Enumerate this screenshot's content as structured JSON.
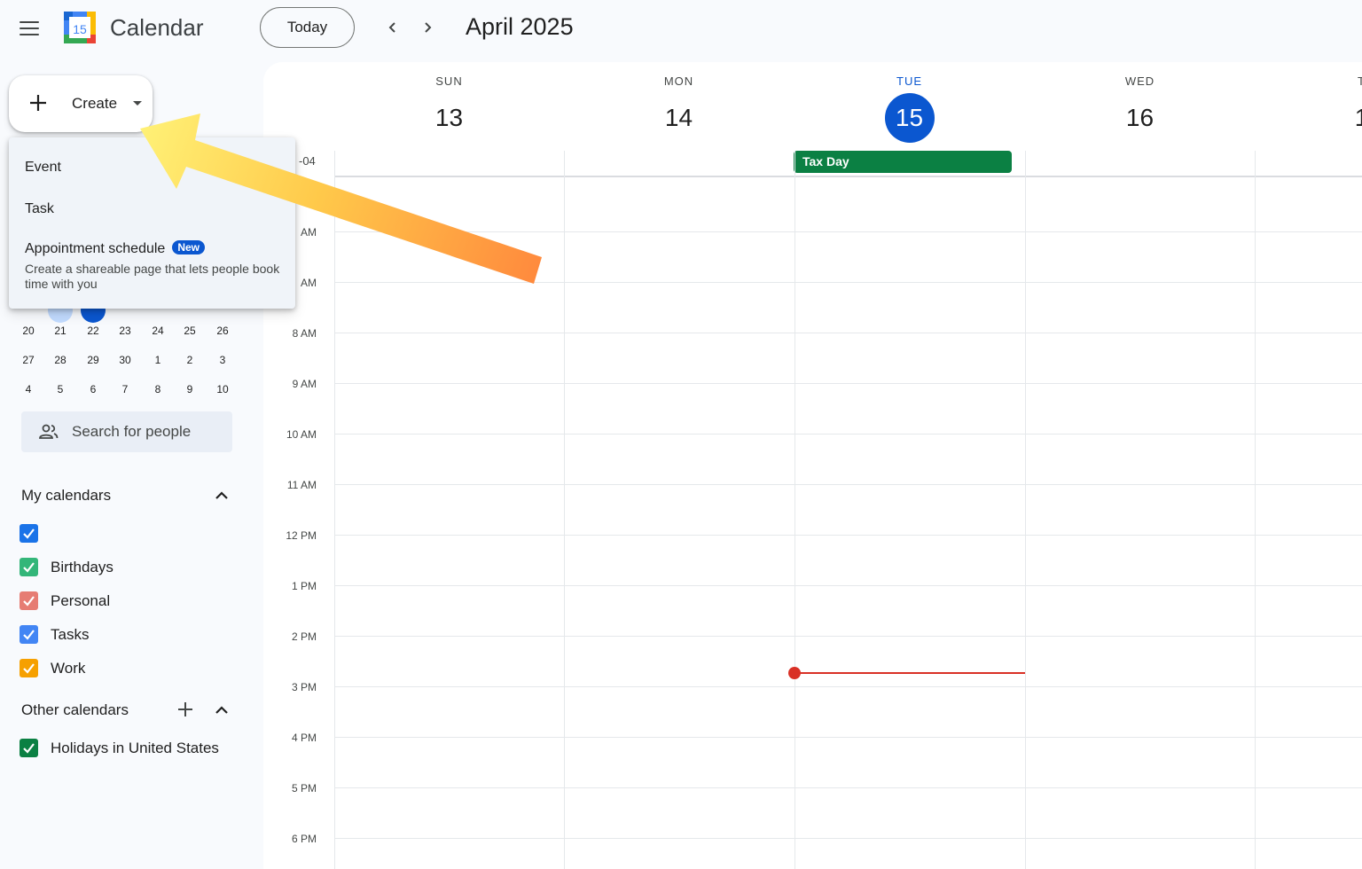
{
  "header": {
    "menu_icon": "hamburger-menu-icon",
    "logo_number": "15",
    "app_title": "Calendar",
    "today_label": "Today",
    "month_title": "April 2025"
  },
  "create": {
    "label": "Create",
    "menu": {
      "event": "Event",
      "task": "Task",
      "appointment": "Appointment schedule",
      "appointment_badge": "New",
      "appointment_desc": "Create a shareable page that lets people book time with you"
    }
  },
  "mini_calendar": {
    "rows": [
      [
        "20",
        "21",
        "22",
        "23",
        "24",
        "25",
        "26"
      ],
      [
        "27",
        "28",
        "29",
        "30",
        "1",
        "2",
        "3"
      ],
      [
        "4",
        "5",
        "6",
        "7",
        "8",
        "9",
        "10"
      ]
    ]
  },
  "search_people": {
    "placeholder": "Search for people"
  },
  "my_calendars": {
    "title": "My calendars",
    "items": [
      {
        "name": "",
        "color": "#1a73e8"
      },
      {
        "name": "Birthdays",
        "color": "#33b679"
      },
      {
        "name": "Personal",
        "color": "#e67c73"
      },
      {
        "name": "Tasks",
        "color": "#4285f4"
      },
      {
        "name": "Work",
        "color": "#f6a000"
      }
    ]
  },
  "other_calendars": {
    "title": "Other calendars",
    "items": [
      {
        "name": "Holidays in United States",
        "color": "#0b8043"
      }
    ]
  },
  "week": {
    "days": [
      {
        "dow": "SUN",
        "num": "13",
        "today": false
      },
      {
        "dow": "MON",
        "num": "14",
        "today": false
      },
      {
        "dow": "TUE",
        "num": "15",
        "today": true
      },
      {
        "dow": "WED",
        "num": "16",
        "today": false
      },
      {
        "dow": "T",
        "num": "1",
        "today": false
      }
    ],
    "timezone": "-04",
    "allday_event": "Tax Day",
    "hours": [
      "AM",
      "AM",
      "8 AM",
      "9 AM",
      "10 AM",
      "11 AM",
      "12 PM",
      "1 PM",
      "2 PM",
      "3 PM",
      "4 PM",
      "5 PM",
      "6 PM"
    ]
  },
  "colors": {
    "accent": "#0b57d0",
    "event_green": "#0b8043",
    "now_indicator": "#d93025",
    "arrow_start": "#fff176",
    "arrow_end": "#ff8a3d"
  }
}
